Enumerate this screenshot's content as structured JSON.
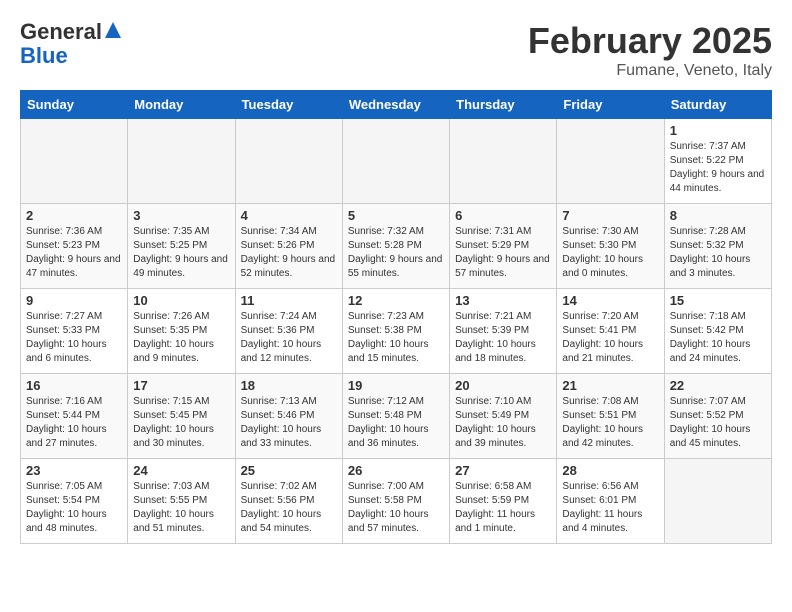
{
  "header": {
    "logo_general": "General",
    "logo_blue": "Blue",
    "month_title": "February 2025",
    "location": "Fumane, Veneto, Italy"
  },
  "days_of_week": [
    "Sunday",
    "Monday",
    "Tuesday",
    "Wednesday",
    "Thursday",
    "Friday",
    "Saturday"
  ],
  "weeks": [
    [
      {
        "num": "",
        "info": ""
      },
      {
        "num": "",
        "info": ""
      },
      {
        "num": "",
        "info": ""
      },
      {
        "num": "",
        "info": ""
      },
      {
        "num": "",
        "info": ""
      },
      {
        "num": "",
        "info": ""
      },
      {
        "num": "1",
        "info": "Sunrise: 7:37 AM\nSunset: 5:22 PM\nDaylight: 9 hours and 44 minutes."
      }
    ],
    [
      {
        "num": "2",
        "info": "Sunrise: 7:36 AM\nSunset: 5:23 PM\nDaylight: 9 hours and 47 minutes."
      },
      {
        "num": "3",
        "info": "Sunrise: 7:35 AM\nSunset: 5:25 PM\nDaylight: 9 hours and 49 minutes."
      },
      {
        "num": "4",
        "info": "Sunrise: 7:34 AM\nSunset: 5:26 PM\nDaylight: 9 hours and 52 minutes."
      },
      {
        "num": "5",
        "info": "Sunrise: 7:32 AM\nSunset: 5:28 PM\nDaylight: 9 hours and 55 minutes."
      },
      {
        "num": "6",
        "info": "Sunrise: 7:31 AM\nSunset: 5:29 PM\nDaylight: 9 hours and 57 minutes."
      },
      {
        "num": "7",
        "info": "Sunrise: 7:30 AM\nSunset: 5:30 PM\nDaylight: 10 hours and 0 minutes."
      },
      {
        "num": "8",
        "info": "Sunrise: 7:28 AM\nSunset: 5:32 PM\nDaylight: 10 hours and 3 minutes."
      }
    ],
    [
      {
        "num": "9",
        "info": "Sunrise: 7:27 AM\nSunset: 5:33 PM\nDaylight: 10 hours and 6 minutes."
      },
      {
        "num": "10",
        "info": "Sunrise: 7:26 AM\nSunset: 5:35 PM\nDaylight: 10 hours and 9 minutes."
      },
      {
        "num": "11",
        "info": "Sunrise: 7:24 AM\nSunset: 5:36 PM\nDaylight: 10 hours and 12 minutes."
      },
      {
        "num": "12",
        "info": "Sunrise: 7:23 AM\nSunset: 5:38 PM\nDaylight: 10 hours and 15 minutes."
      },
      {
        "num": "13",
        "info": "Sunrise: 7:21 AM\nSunset: 5:39 PM\nDaylight: 10 hours and 18 minutes."
      },
      {
        "num": "14",
        "info": "Sunrise: 7:20 AM\nSunset: 5:41 PM\nDaylight: 10 hours and 21 minutes."
      },
      {
        "num": "15",
        "info": "Sunrise: 7:18 AM\nSunset: 5:42 PM\nDaylight: 10 hours and 24 minutes."
      }
    ],
    [
      {
        "num": "16",
        "info": "Sunrise: 7:16 AM\nSunset: 5:44 PM\nDaylight: 10 hours and 27 minutes."
      },
      {
        "num": "17",
        "info": "Sunrise: 7:15 AM\nSunset: 5:45 PM\nDaylight: 10 hours and 30 minutes."
      },
      {
        "num": "18",
        "info": "Sunrise: 7:13 AM\nSunset: 5:46 PM\nDaylight: 10 hours and 33 minutes."
      },
      {
        "num": "19",
        "info": "Sunrise: 7:12 AM\nSunset: 5:48 PM\nDaylight: 10 hours and 36 minutes."
      },
      {
        "num": "20",
        "info": "Sunrise: 7:10 AM\nSunset: 5:49 PM\nDaylight: 10 hours and 39 minutes."
      },
      {
        "num": "21",
        "info": "Sunrise: 7:08 AM\nSunset: 5:51 PM\nDaylight: 10 hours and 42 minutes."
      },
      {
        "num": "22",
        "info": "Sunrise: 7:07 AM\nSunset: 5:52 PM\nDaylight: 10 hours and 45 minutes."
      }
    ],
    [
      {
        "num": "23",
        "info": "Sunrise: 7:05 AM\nSunset: 5:54 PM\nDaylight: 10 hours and 48 minutes."
      },
      {
        "num": "24",
        "info": "Sunrise: 7:03 AM\nSunset: 5:55 PM\nDaylight: 10 hours and 51 minutes."
      },
      {
        "num": "25",
        "info": "Sunrise: 7:02 AM\nSunset: 5:56 PM\nDaylight: 10 hours and 54 minutes."
      },
      {
        "num": "26",
        "info": "Sunrise: 7:00 AM\nSunset: 5:58 PM\nDaylight: 10 hours and 57 minutes."
      },
      {
        "num": "27",
        "info": "Sunrise: 6:58 AM\nSunset: 5:59 PM\nDaylight: 11 hours and 1 minute."
      },
      {
        "num": "28",
        "info": "Sunrise: 6:56 AM\nSunset: 6:01 PM\nDaylight: 11 hours and 4 minutes."
      },
      {
        "num": "",
        "info": ""
      }
    ]
  ]
}
